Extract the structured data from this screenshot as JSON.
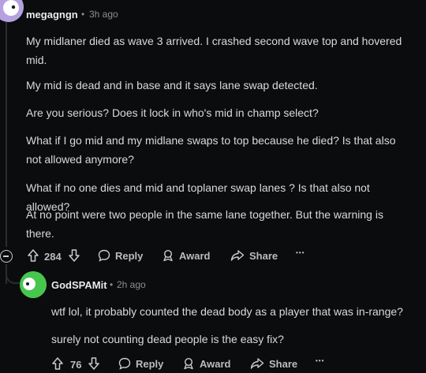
{
  "comment": {
    "author": "megagngn",
    "separator": "•",
    "time": "3h ago",
    "paragraphs": [
      "My midlaner died as wave 3 arrived. I crashed second wave top and hovered mid.",
      "My mid is dead and in base and it says lane swap detected.",
      "Are you serious? Does it lock in who's mid in champ select?",
      "What if I go mid and my midlane swaps to top because he died? Is that also not allowed anymore?",
      "What if no one dies and mid and toplaner swap lanes ? Is that also not allowed?",
      "At no point were two people in the same lane together. But the warning is there."
    ],
    "votes": "284",
    "reply_label": "Reply",
    "award_label": "Award",
    "share_label": "Share",
    "more_label": "•••"
  },
  "reply": {
    "author": "GodSPAMit",
    "separator": "•",
    "time": "2h ago",
    "paragraphs": [
      "wtf lol, it probably counted the dead body as a player that was in-range?",
      "surely not counting dead people is the easy fix?"
    ],
    "votes": "76",
    "reply_label": "Reply",
    "award_label": "Award",
    "share_label": "Share",
    "more_label": "•••"
  }
}
